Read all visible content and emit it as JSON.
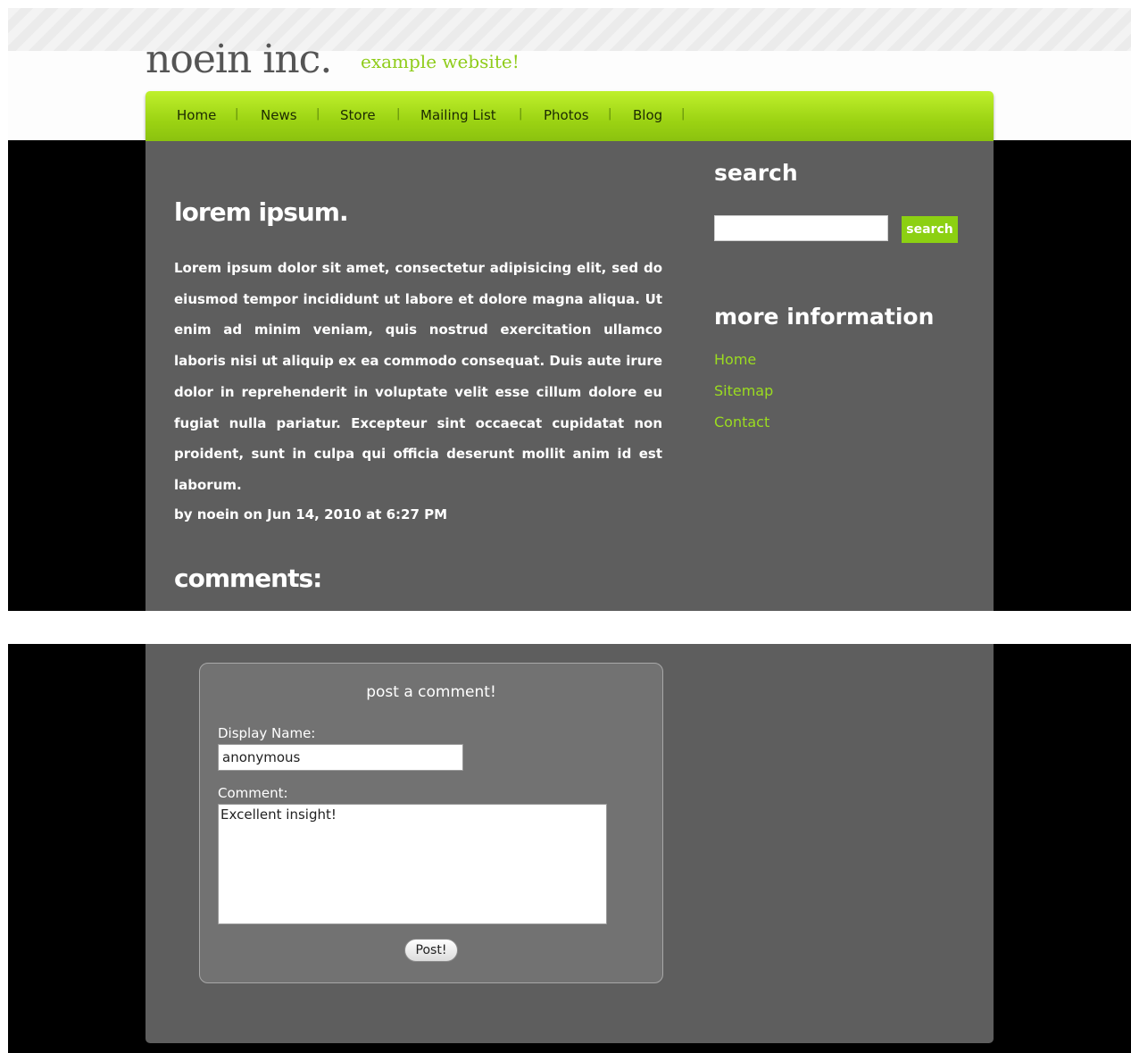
{
  "site": {
    "logo": "noein inc.",
    "tagline": "example website!"
  },
  "nav": {
    "items": [
      "Home",
      "News",
      "Store",
      "Mailing List",
      "Photos",
      "Blog"
    ],
    "separator": "|"
  },
  "post": {
    "title": "lorem ipsum.",
    "body": "Lorem ipsum dolor sit amet, consectetur adipisicing elit, sed do eiusmod tempor incididunt ut labore et dolore magna aliqua. Ut enim ad minim veniam, quis nostrud exercitation ullamco laboris nisi ut aliquip ex ea commodo consequat. Duis aute irure dolor in reprehenderit in voluptate velit esse cillum dolore eu fugiat nulla pariatur. Excepteur sint occaecat cupidatat non proident, sunt in culpa qui officia deserunt mollit anim id est laborum.",
    "meta": "by noein on Jun 14, 2010 at 6:27 PM",
    "comments_heading": "comments:"
  },
  "sidebar": {
    "search_heading": "search",
    "search_value": "",
    "search_button": "search",
    "info_heading": "more information",
    "links": [
      "Home",
      "Sitemap",
      "Contact"
    ]
  },
  "comment_form": {
    "title": "post a comment!",
    "name_label": "Display Name:",
    "name_value": "anonymous",
    "comment_label": "Comment:",
    "comment_value": "Excellent insight!",
    "submit_label": "Post!"
  },
  "colors": {
    "accent": "#9bdc20",
    "nav_bar": "#a6dc18",
    "content_bg": "#5e5e5e",
    "form_bg": "#727272"
  }
}
